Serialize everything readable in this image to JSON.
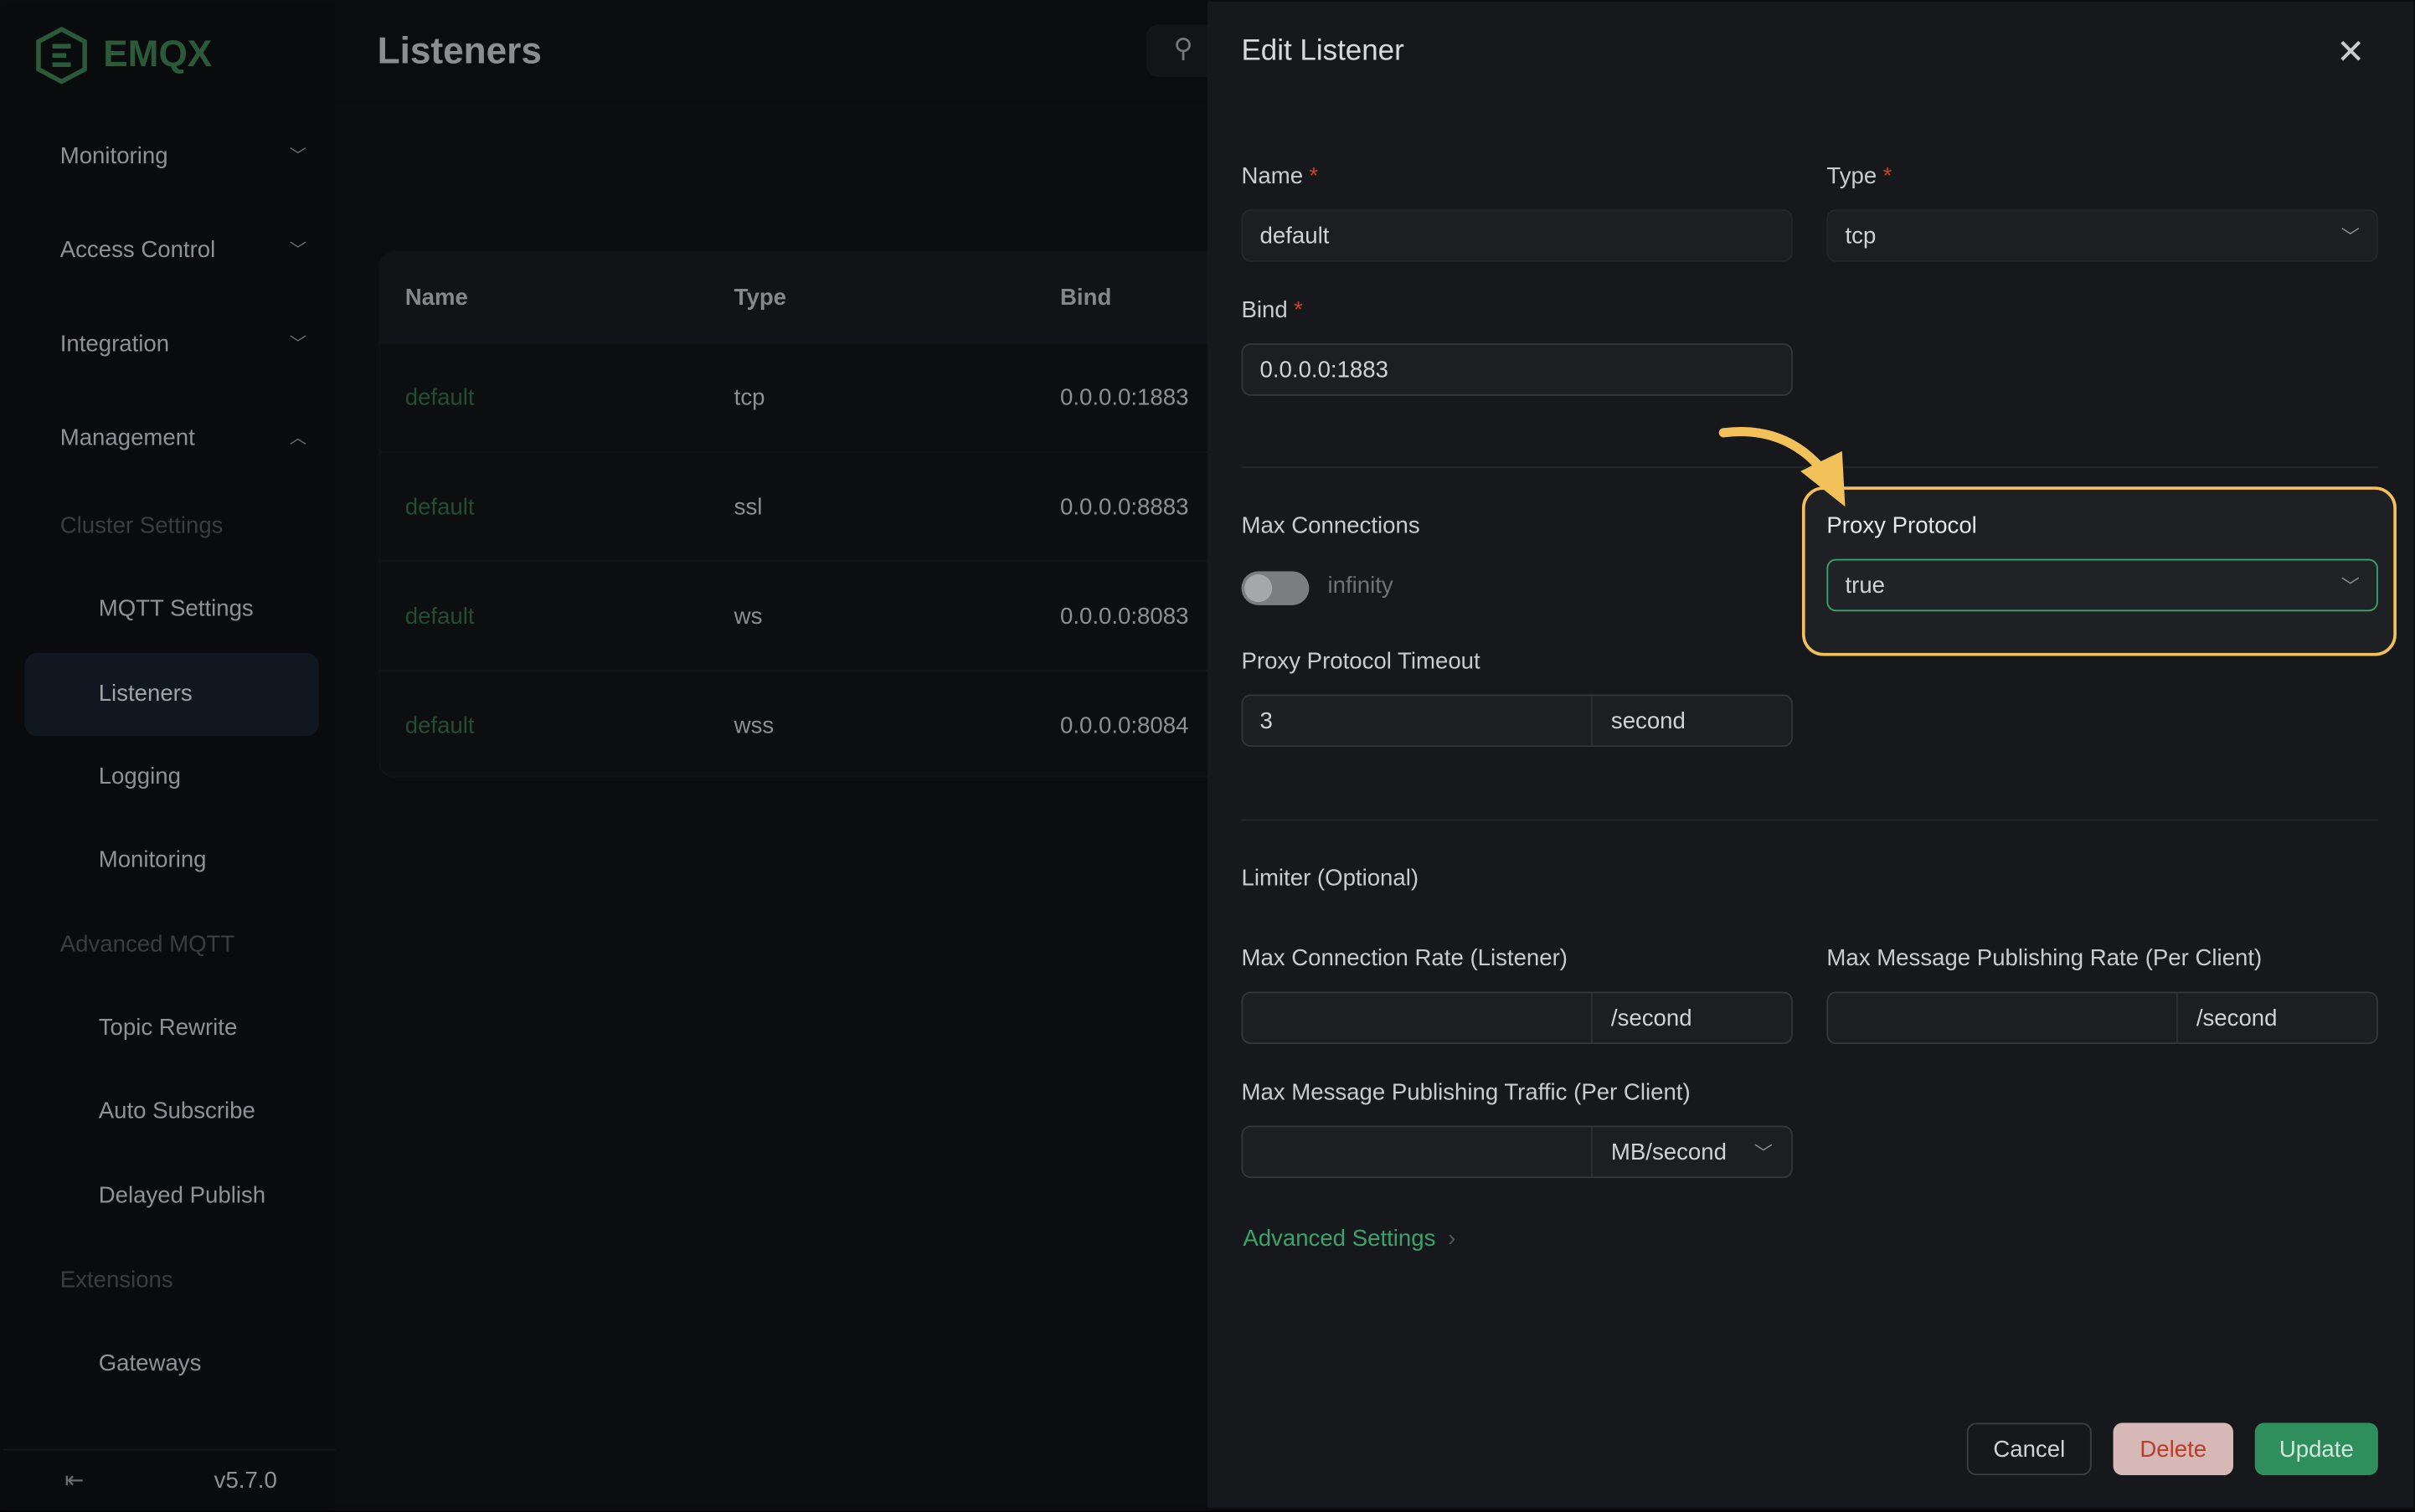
{
  "app": {
    "logo_text": "EMQX",
    "version": "v5.7.0"
  },
  "sidebar": {
    "items": [
      {
        "label": "Monitoring",
        "type": "menu",
        "state": "collapsed"
      },
      {
        "label": "Access Control",
        "type": "menu",
        "state": "collapsed"
      },
      {
        "label": "Integration",
        "type": "menu",
        "state": "collapsed"
      },
      {
        "label": "Management",
        "type": "menu",
        "state": "expanded"
      },
      {
        "label": "Cluster Settings",
        "type": "group"
      },
      {
        "label": "MQTT Settings",
        "type": "item"
      },
      {
        "label": "Listeners",
        "type": "item",
        "active": true
      },
      {
        "label": "Logging",
        "type": "item"
      },
      {
        "label": "Monitoring",
        "type": "item"
      },
      {
        "label": "Advanced MQTT",
        "type": "group"
      },
      {
        "label": "Topic Rewrite",
        "type": "item"
      },
      {
        "label": "Auto Subscribe",
        "type": "item"
      },
      {
        "label": "Delayed Publish",
        "type": "item"
      },
      {
        "label": "Extensions",
        "type": "group"
      },
      {
        "label": "Gateways",
        "type": "item"
      }
    ]
  },
  "main": {
    "title": "Listeners",
    "table": {
      "columns": [
        "Name",
        "Type",
        "Bind"
      ],
      "rows": [
        [
          "default",
          "tcp",
          "0.0.0.0:1883"
        ],
        [
          "default",
          "ssl",
          "0.0.0.0:8883"
        ],
        [
          "default",
          "ws",
          "0.0.0.0:8083"
        ],
        [
          "default",
          "wss",
          "0.0.0.0:8084"
        ]
      ]
    }
  },
  "drawer": {
    "title": "Edit Listener",
    "name": {
      "label": "Name",
      "value": "default"
    },
    "type": {
      "label": "Type",
      "value": "tcp"
    },
    "bind": {
      "label": "Bind",
      "value": "0.0.0.0:1883"
    },
    "max_connections": {
      "label": "Max Connections",
      "toggle_label": "infinity",
      "enabled": false
    },
    "proxy_protocol": {
      "label": "Proxy Protocol",
      "value": "true"
    },
    "proxy_timeout": {
      "label": "Proxy Protocol Timeout",
      "value": "3",
      "unit": "second"
    },
    "limiter": {
      "title": "Limiter (Optional)",
      "conn_rate": {
        "label": "Max Connection Rate (Listener)",
        "value": "",
        "unit": "/second"
      },
      "msg_rate": {
        "label": "Max Message Publishing Rate (Per Client)",
        "value": "",
        "unit": "/second"
      },
      "traffic": {
        "label": "Max Message Publishing Traffic (Per Client)",
        "value": "",
        "unit": "MB/second"
      }
    },
    "advanced": "Advanced Settings",
    "buttons": {
      "cancel": "Cancel",
      "delete": "Delete",
      "update": "Update"
    },
    "required_mark": "*"
  },
  "colors": {
    "accent": "#3aa36b",
    "highlight": "#f2c15a",
    "danger": "#c0462e"
  }
}
